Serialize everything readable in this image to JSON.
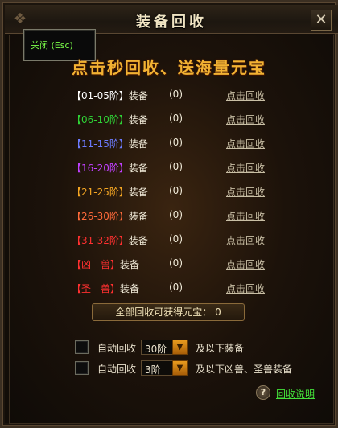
{
  "window": {
    "title": "装备回收",
    "close_glyph": "✕"
  },
  "esc_tip": "关闭 (Esc)",
  "banner": "点击秒回收、送海量元宝",
  "rows": [
    {
      "range": "【01-05阶】",
      "label": "装备",
      "count": "(0)",
      "action": "点击回收",
      "color": "#ffffff"
    },
    {
      "range": "【06-10阶】",
      "label": "装备",
      "count": "(0)",
      "action": "点击回收",
      "color": "#2fd336"
    },
    {
      "range": "【11-15阶】",
      "label": "装备",
      "count": "(0)",
      "action": "点击回收",
      "color": "#6c7bff"
    },
    {
      "range": "【16-20阶】",
      "label": "装备",
      "count": "(0)",
      "action": "点击回收",
      "color": "#c040ff"
    },
    {
      "range": "【21-25阶】",
      "label": "装备",
      "count": "(0)",
      "action": "点击回收",
      "color": "#f5a623"
    },
    {
      "range": "【26-30阶】",
      "label": "装备",
      "count": "(0)",
      "action": "点击回收",
      "color": "#ff6a3a"
    },
    {
      "range": "【31-32阶】",
      "label": "装备",
      "count": "(0)",
      "action": "点击回收",
      "color": "#ff3030"
    },
    {
      "range": "【凶　兽】",
      "label": "装备",
      "count": "(0)",
      "action": "点击回收",
      "color": "#ff3030"
    },
    {
      "range": "【圣　兽】",
      "label": "装备",
      "count": "(0)",
      "action": "点击回收",
      "color": "#ff3030"
    }
  ],
  "total": {
    "label": "全部回收可获得元宝：",
    "value": "0"
  },
  "auto": [
    {
      "label": "自动回收",
      "selected": "30阶",
      "suffix": "及以下装备"
    },
    {
      "label": "自动回收",
      "selected": "3阶",
      "suffix": "及以下凶兽、圣兽装备"
    }
  ],
  "help": {
    "icon": "?",
    "label": "回收说明"
  },
  "icons": {
    "close": "close-icon",
    "dropdown": "chevron-down-icon",
    "help": "question-icon"
  }
}
